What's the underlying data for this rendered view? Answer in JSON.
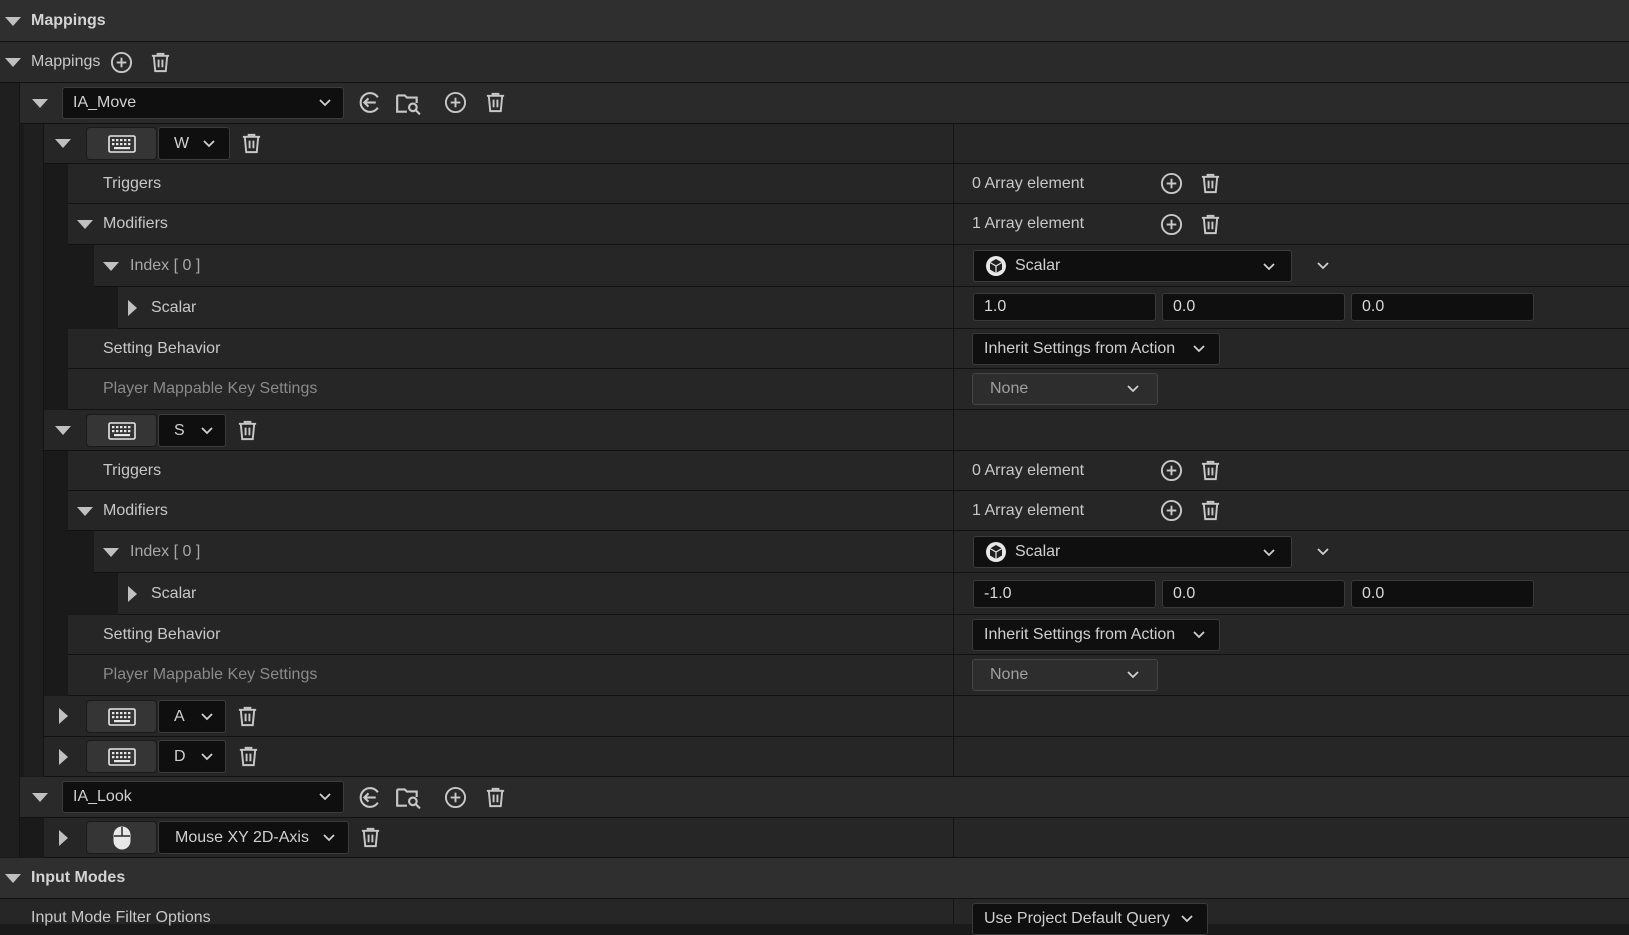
{
  "section_mappings": {
    "title": "Mappings"
  },
  "mappings_array": {
    "label": "Mappings"
  },
  "actions": [
    {
      "name": "IA_Move",
      "keys": [
        {
          "key": "W",
          "triggers": {
            "label": "Triggers",
            "value": "0 Array element"
          },
          "modifiers": {
            "label": "Modifiers",
            "value": "1 Array element"
          },
          "index": {
            "label": "Index [ 0 ]",
            "class": "Scalar"
          },
          "scalar": {
            "label": "Scalar",
            "x": "1.0",
            "y": "0.0",
            "z": "0.0"
          },
          "setting_behavior": {
            "label": "Setting Behavior",
            "value": "Inherit Settings from Action"
          },
          "player_mappable": {
            "label": "Player Mappable Key Settings",
            "value": "None"
          }
        },
        {
          "key": "S",
          "triggers": {
            "label": "Triggers",
            "value": "0 Array element"
          },
          "modifiers": {
            "label": "Modifiers",
            "value": "1 Array element"
          },
          "index": {
            "label": "Index [ 0 ]",
            "class": "Scalar"
          },
          "scalar": {
            "label": "Scalar",
            "x": "-1.0",
            "y": "0.0",
            "z": "0.0"
          },
          "setting_behavior": {
            "label": "Setting Behavior",
            "value": "Inherit Settings from Action"
          },
          "player_mappable": {
            "label": "Player Mappable Key Settings",
            "value": "None"
          }
        },
        {
          "key": "A"
        },
        {
          "key": "D"
        }
      ]
    },
    {
      "name": "IA_Look",
      "keys": [
        {
          "key": "Mouse XY 2D-Axis"
        }
      ]
    }
  ],
  "section_input_modes": {
    "title": "Input Modes",
    "filter_label": "Input Mode Filter Options",
    "filter_value": "Use Project Default Query"
  },
  "icons": {
    "add": "plus-circle-icon",
    "delete": "trash-icon",
    "browse_back": "arrow-left-circle-icon",
    "browse_folder": "folder-search-icon",
    "keyboard": "keyboard-icon",
    "mouse": "mouse-icon",
    "class": "class-cube-icon"
  },
  "colors": {
    "panel": "#262626",
    "header": "#2f2f2f",
    "field": "#0f0f0f",
    "text": "#c8c8c8"
  }
}
